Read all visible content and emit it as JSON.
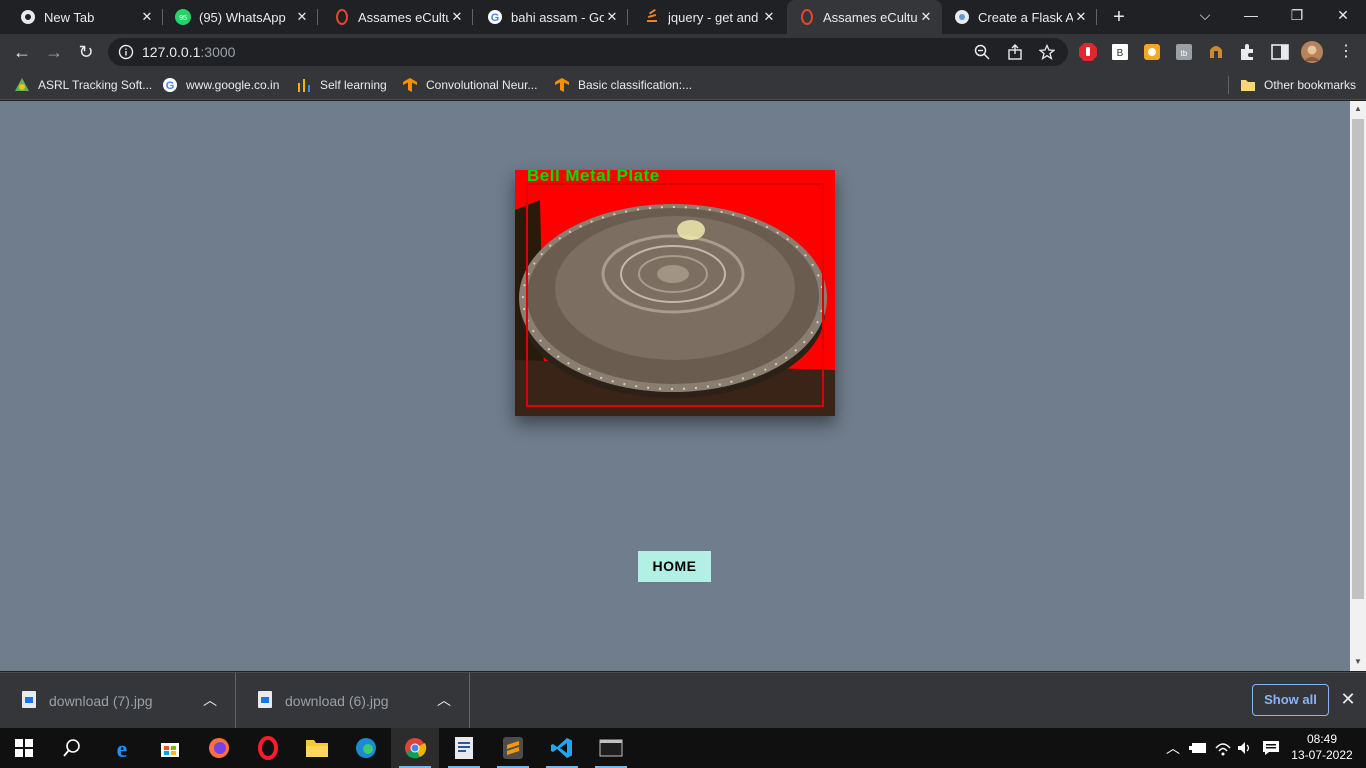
{
  "browser": {
    "tabs": [
      {
        "title": "New Tab",
        "icon": "chrome-icon"
      },
      {
        "title": "(95) WhatsApp",
        "icon": "whatsapp-icon",
        "badge": "95"
      },
      {
        "title": "Assames eCulture",
        "icon": "opera-like-icon"
      },
      {
        "title": "bahi assam - Goo",
        "icon": "google-icon"
      },
      {
        "title": "jquery - get and f",
        "icon": "stackoverflow-icon"
      },
      {
        "title": "Assames eCulture",
        "icon": "opera-like-icon",
        "active": true
      },
      {
        "title": "Create a Flask Ap",
        "icon": "puzzle-icon"
      }
    ],
    "url_host": "127.0.0.1",
    "url_port": ":3000",
    "bookmarks": [
      {
        "label": "ASRL Tracking Soft...",
        "icon": "asrl-icon"
      },
      {
        "label": "www.google.co.in",
        "icon": "google-icon"
      },
      {
        "label": "Self learning",
        "icon": "chart-icon"
      },
      {
        "label": "Convolutional Neur...",
        "icon": "tensorflow-icon"
      },
      {
        "label": "Basic classification:...",
        "icon": "tensorflow-icon"
      }
    ],
    "other_bookmarks": "Other bookmarks"
  },
  "page": {
    "image_label": "Bell Metal Plate",
    "home_label": "HOME",
    "background_color": "#6f7d8c"
  },
  "downloads": {
    "items": [
      {
        "name": "download (7).jpg"
      },
      {
        "name": "download (6).jpg"
      }
    ],
    "show_all": "Show all"
  },
  "taskbar": {
    "time": "08:49",
    "date": "13-07-2022"
  }
}
